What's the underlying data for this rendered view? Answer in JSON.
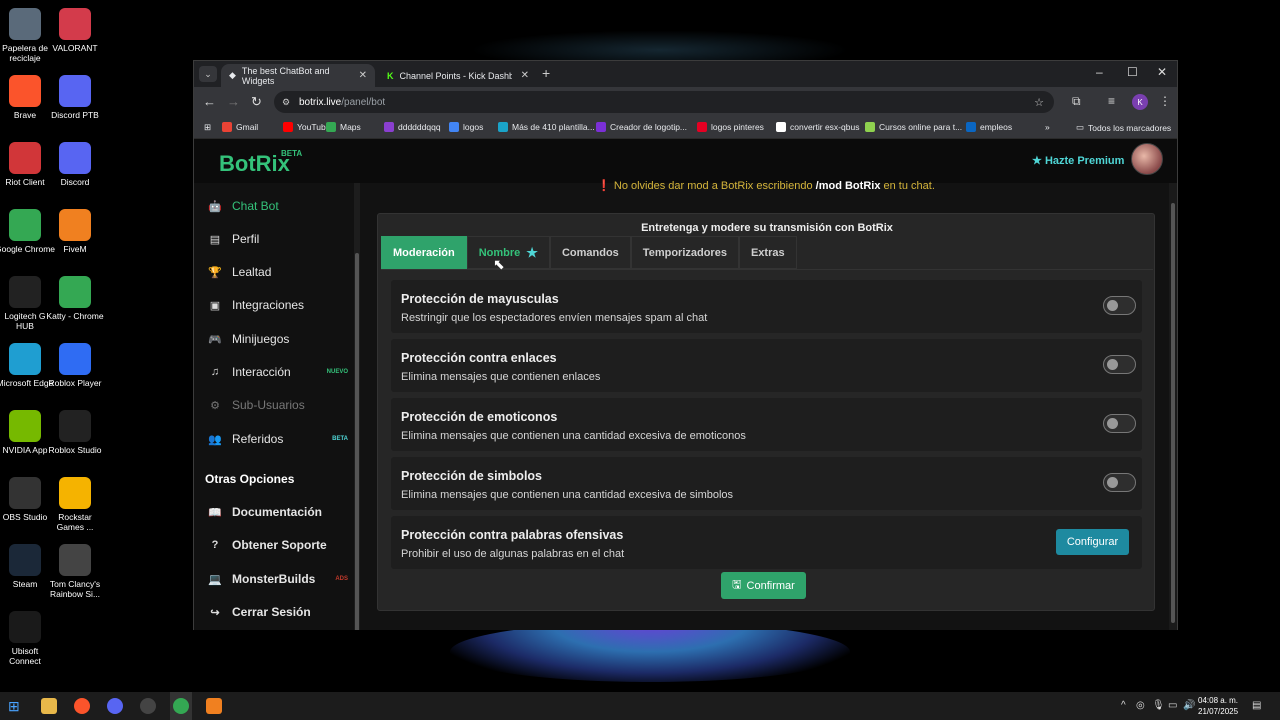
{
  "desktop": {
    "icons": [
      {
        "label": "Papelera de reciclaje",
        "icon": "recycle-bin-icon",
        "color": "#5a6a7a"
      },
      {
        "label": "VALORANT",
        "icon": "valorant-icon",
        "color": "#d33b4b"
      },
      {
        "label": "Brave",
        "icon": "brave-icon",
        "color": "#fb542b"
      },
      {
        "label": "Discord PTB",
        "icon": "discord-icon",
        "color": "#5865f2"
      },
      {
        "label": "Riot Client",
        "icon": "riot-icon",
        "color": "#d13639"
      },
      {
        "label": "Discord",
        "icon": "discord-icon",
        "color": "#5865f2"
      },
      {
        "label": "Google Chrome",
        "icon": "chrome-icon",
        "color": "#34a853"
      },
      {
        "label": "FiveM",
        "icon": "fivem-icon",
        "color": "#f08020"
      },
      {
        "label": "Logitech G HUB",
        "icon": "logitech-icon",
        "color": "#222222"
      },
      {
        "label": "Katty - Chrome",
        "icon": "chrome-icon",
        "color": "#34a853"
      },
      {
        "label": "Microsoft Edge",
        "icon": "edge-icon",
        "color": "#1f9ed1"
      },
      {
        "label": "Roblox Player",
        "icon": "roblox-icon",
        "color": "#2f6cf3"
      },
      {
        "label": "NVIDIA App",
        "icon": "nvidia-icon",
        "color": "#76b900"
      },
      {
        "label": "Roblox Studio",
        "icon": "roblox-studio-icon",
        "color": "#222222"
      },
      {
        "label": "OBS Studio",
        "icon": "obs-icon",
        "color": "#333333"
      },
      {
        "label": "Rockstar Games ...",
        "icon": "rockstar-icon",
        "color": "#f5b300"
      },
      {
        "label": "Steam",
        "icon": "steam-icon",
        "color": "#1b2838"
      },
      {
        "label": "Tom Clancy's Rainbow Si...",
        "icon": "rainbow-six-icon",
        "color": "#444444"
      },
      {
        "label": "Ubisoft Connect",
        "icon": "ubisoft-icon",
        "color": "#1a1a1a"
      }
    ]
  },
  "browser": {
    "tabs": [
      {
        "label": "The best ChatBot and Widgets",
        "active": true
      },
      {
        "label": "Channel Points - Kick Dashboa",
        "active": false
      }
    ],
    "url_host": "botrix.live",
    "url_path": "/panel/bot",
    "bookmarks": [
      "Gmail",
      "YouTube",
      "Maps",
      "ddddddqqq",
      "logos",
      "Más de 410 plantilla...",
      "Creador de logotip...",
      "logos pinteres",
      "convertir esx-qbus",
      "Cursos online para t...",
      "empleos"
    ],
    "all_bookmarks": "Todos los marcadores",
    "profile_initial": "K"
  },
  "header": {
    "logo": "BotRix",
    "logo_badge": "BETA",
    "premium": "Hazte Premium"
  },
  "sidebar": {
    "items": [
      {
        "label": "Chat Bot",
        "icon": "robot-icon",
        "state": "active"
      },
      {
        "label": "Perfil",
        "icon": "id-card-icon",
        "state": "normal"
      },
      {
        "label": "Lealtad",
        "icon": "trophy-icon",
        "state": "normal"
      },
      {
        "label": "Integraciones",
        "icon": "integration-icon",
        "state": "normal"
      },
      {
        "label": "Minijuegos",
        "icon": "gamepad-icon",
        "state": "normal"
      },
      {
        "label": "Interacción",
        "icon": "music-icon",
        "state": "normal",
        "badge": "NUEVO"
      },
      {
        "label": "Sub-Usuarios",
        "icon": "users-cog-icon",
        "state": "disabled"
      },
      {
        "label": "Referidos",
        "icon": "users-icon",
        "state": "normal",
        "badge": "BETA"
      }
    ],
    "other_title": "Otras Opciones",
    "other_items": [
      {
        "label": "Documentación",
        "icon": "book-icon"
      },
      {
        "label": "Obtener Soporte",
        "icon": "question-icon"
      },
      {
        "label": "MonsterBuilds",
        "icon": "laptop-icon",
        "badge": "ADS"
      },
      {
        "label": "Cerrar Sesión",
        "icon": "logout-icon"
      }
    ]
  },
  "main": {
    "notice_pre": "No olvides dar mod a BotRix escribiendo",
    "notice_cmd": "/mod BotRix",
    "notice_post": "en tu chat.",
    "card_title": "Entretenga y modere su transmisión con BotRix",
    "tabs": [
      "Moderación",
      "Nombre",
      "Comandos",
      "Temporizadores",
      "Extras"
    ],
    "options": [
      {
        "title": "Protección de mayusculas",
        "desc": "Restringir que los espectadores envíen mensajes spam al chat",
        "enabled": false
      },
      {
        "title": "Protección contra enlaces",
        "desc": "Elimina mensajes que contienen enlaces",
        "enabled": false
      },
      {
        "title": "Protección de emoticonos",
        "desc": "Elimina mensajes que contienen una cantidad excesiva de emoticonos",
        "enabled": false
      },
      {
        "title": "Protección de simbolos",
        "desc": "Elimina mensajes que contienen una cantidad excesiva de simbolos",
        "enabled": false
      },
      {
        "title": "Protección contra palabras ofensivas",
        "desc": "Prohibir el uso de algunas palabras en el chat"
      }
    ],
    "configure_label": "Configurar",
    "confirm_label": "Confirmar"
  },
  "taskbar": {
    "time": "04:08 a. m.",
    "date": "21/07/2025"
  },
  "colors": {
    "accent_green": "#2fa36b",
    "accent_cyan": "#4fd6d6",
    "configure_btn": "#1e8aa0",
    "notice": "#d4b43a"
  }
}
